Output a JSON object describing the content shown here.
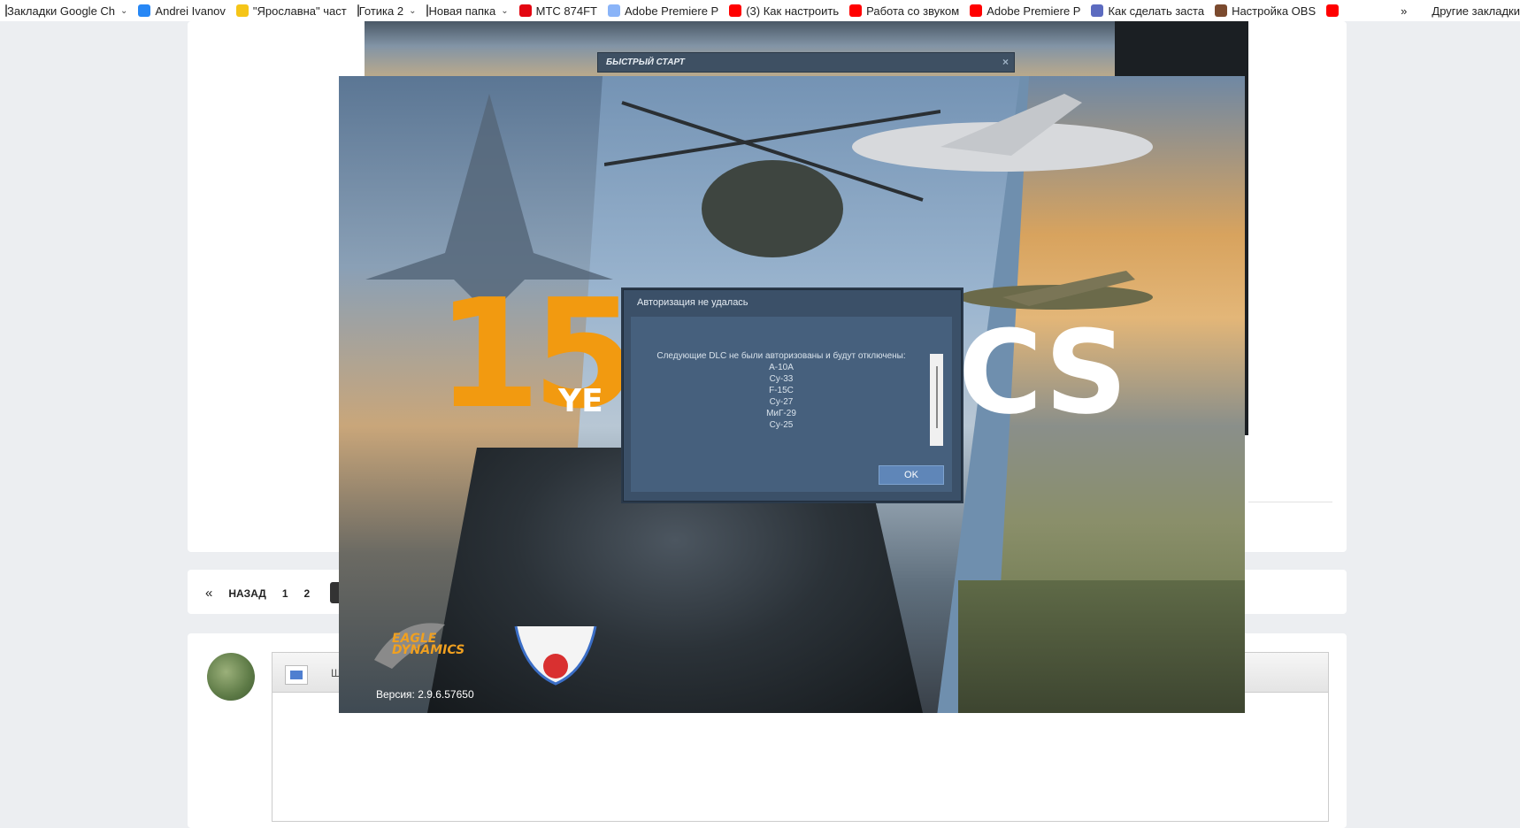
{
  "bookmarks": {
    "items": [
      {
        "label": "Закладки Google Ch",
        "icon": "folder-icon",
        "chevron": true
      },
      {
        "label": "Andrei Ivanov",
        "icon": "vk-icon",
        "color": "#2787f5"
      },
      {
        "label": "\"Ярославна\" част",
        "icon": "yu-icon",
        "color": "#f5c518"
      },
      {
        "label": "Готика 2",
        "icon": "folder-icon",
        "chevron": true
      },
      {
        "label": "Новая папка",
        "icon": "folder-icon",
        "chevron": true
      },
      {
        "label": "МТС 874FT",
        "icon": "mts-icon",
        "color": "#e30611"
      },
      {
        "label": "Adobe Premiere P",
        "icon": "star-icon",
        "color": "#8ab4f8"
      },
      {
        "label": "(3) Как настроить",
        "icon": "youtube-icon",
        "color": "#ff0000"
      },
      {
        "label": "Работа со звуком",
        "icon": "youtube-icon",
        "color": "#ff0000"
      },
      {
        "label": "Adobe Premiere P",
        "icon": "youtube-icon",
        "color": "#ff0000"
      },
      {
        "label": "Как сделать заста",
        "icon": "book-icon",
        "color": "#5c6bc0"
      },
      {
        "label": "Настройка OBS",
        "icon": "image-icon",
        "color": "#7b4a2e"
      },
      {
        "label": "",
        "icon": "youtube-icon",
        "color": "#ff0000"
      }
    ],
    "overflow": "»",
    "other": "Другие закладки"
  },
  "pager": {
    "prev_icon": "«",
    "back_label": "НАЗАД",
    "pages": [
      "1",
      "2"
    ]
  },
  "editor": {
    "toolbar_letter": "Ш"
  },
  "launcher": {
    "quick_start_title": "БЫСТРЫЙ СТАРТ",
    "close_glyph": "×",
    "splash": {
      "number": "15",
      "years": "YE",
      "brand": "CS",
      "logo_text": "EAGLE\nDYNAMICS",
      "version": "Версия: 2.9.6.57650"
    }
  },
  "dialog": {
    "title": "Авторизация не удалась",
    "message": "Следующие DLC не были авторизованы и будут отключены:",
    "dlc": [
      "A-10A",
      "Су-33",
      "F-15C",
      "Су-27",
      "МиГ-29",
      "Су-25"
    ],
    "ok_label": "OK"
  }
}
